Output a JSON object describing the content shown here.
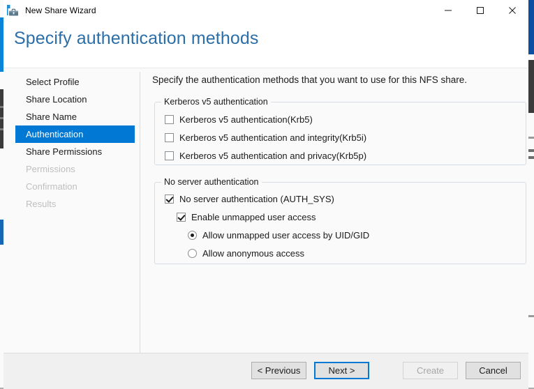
{
  "window": {
    "title": "New Share Wizard",
    "icon": "toolbox-icon",
    "controls": {
      "minimize": "minimize-icon",
      "maximize": "maximize-icon",
      "close": "close-icon"
    }
  },
  "header": {
    "page_title": "Specify authentication methods",
    "accent_color": "#2b6ea8"
  },
  "nav": {
    "selected_color": "#0078d4",
    "items": [
      {
        "label": "Select Profile",
        "state": "normal"
      },
      {
        "label": "Share Location",
        "state": "normal"
      },
      {
        "label": "Share Name",
        "state": "normal"
      },
      {
        "label": "Authentication",
        "state": "selected"
      },
      {
        "label": "Share Permissions",
        "state": "normal"
      },
      {
        "label": "Permissions",
        "state": "disabled"
      },
      {
        "label": "Confirmation",
        "state": "disabled"
      },
      {
        "label": "Results",
        "state": "disabled"
      }
    ]
  },
  "main": {
    "intro": "Specify the authentication methods that you want to use for this NFS share.",
    "groups": [
      {
        "legend": "Kerberos v5 authentication",
        "options": [
          {
            "type": "checkbox",
            "label": "Kerberos v5 authentication(Krb5)",
            "checked": false
          },
          {
            "type": "checkbox",
            "label": "Kerberos v5 authentication and integrity(Krb5i)",
            "checked": false
          },
          {
            "type": "checkbox",
            "label": "Kerberos v5 authentication and privacy(Krb5p)",
            "checked": false
          }
        ]
      },
      {
        "legend": "No server authentication",
        "options": [
          {
            "type": "checkbox",
            "label": "No server authentication (AUTH_SYS)",
            "checked": true
          },
          {
            "type": "checkbox",
            "label": "Enable unmapped user access",
            "checked": true
          },
          {
            "type": "radio",
            "label": "Allow unmapped user access by UID/GID",
            "checked": true
          },
          {
            "type": "radio",
            "label": "Allow anonymous access",
            "checked": false
          }
        ]
      }
    ]
  },
  "footer": {
    "buttons": [
      {
        "label": "< Previous",
        "state": "normal"
      },
      {
        "label": "Next >",
        "state": "default"
      },
      {
        "label": "Create",
        "state": "disabled"
      },
      {
        "label": "Cancel",
        "state": "normal"
      }
    ]
  }
}
